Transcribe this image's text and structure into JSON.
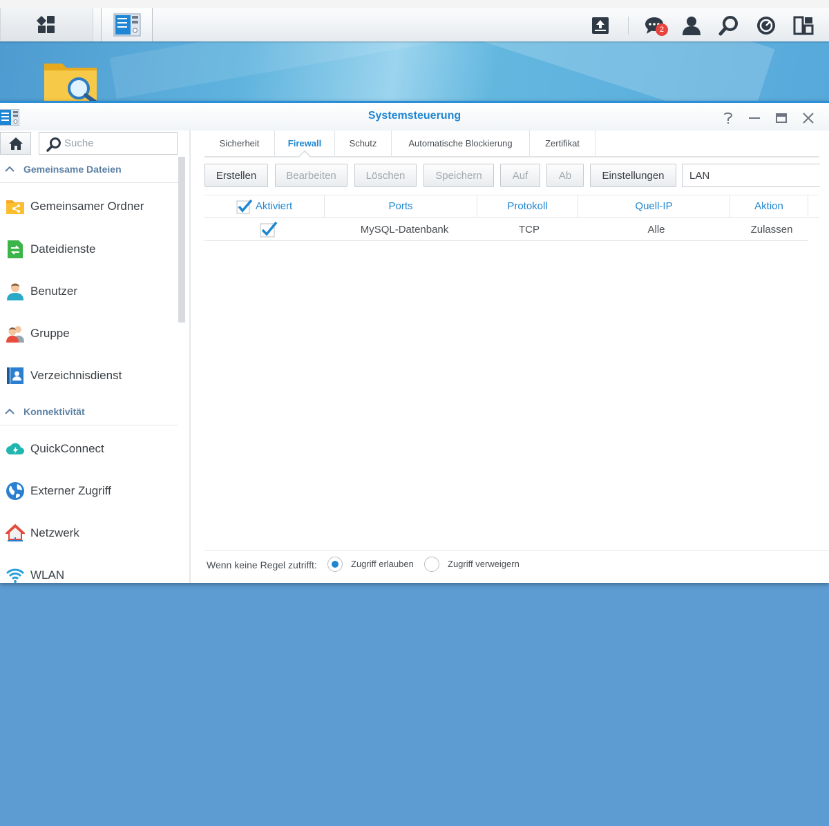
{
  "taskbar": {
    "main_menu_icon": "main-menu-icon",
    "control_panel_icon": "control-panel-icon",
    "right_icons": [
      "upload-icon",
      "notifications-icon",
      "user-icon",
      "search-icon",
      "resource-monitor-icon",
      "widgets-icon"
    ],
    "notification_count": "2"
  },
  "desktop": {
    "icon": "file-station-icon"
  },
  "window": {
    "title": "Systemsteuerung",
    "controls": [
      "help-icon",
      "minimize-icon",
      "maximize-icon",
      "close-icon"
    ]
  },
  "sidebar": {
    "search_placeholder": "Suche",
    "sections": [
      {
        "title": "Gemeinsame Dateien",
        "items": [
          {
            "label": "Gemeinsamer Ordner",
            "icon": "shared-folder-icon"
          },
          {
            "label": "Dateidienste",
            "icon": "file-services-icon"
          },
          {
            "label": "Benutzer",
            "icon": "user-icon"
          },
          {
            "label": "Gruppe",
            "icon": "group-icon"
          },
          {
            "label": "Verzeichnisdienst",
            "icon": "directory-service-icon"
          }
        ]
      },
      {
        "title": "Konnektivität",
        "items": [
          {
            "label": "QuickConnect",
            "icon": "quickconnect-icon"
          },
          {
            "label": "Externer Zugriff",
            "icon": "external-access-icon"
          },
          {
            "label": "Netzwerk",
            "icon": "network-icon"
          },
          {
            "label": "WLAN",
            "icon": "wlan-icon"
          }
        ]
      }
    ]
  },
  "tabs": [
    {
      "label": "Sicherheit",
      "active": false
    },
    {
      "label": "Firewall",
      "active": true
    },
    {
      "label": "Schutz",
      "active": false
    },
    {
      "label": "Automatische Blockierung",
      "active": false
    },
    {
      "label": "Zertifikat",
      "active": false
    }
  ],
  "toolbar": {
    "buttons": [
      {
        "label": "Erstellen",
        "enabled": true
      },
      {
        "label": "Bearbeiten",
        "enabled": false
      },
      {
        "label": "Löschen",
        "enabled": false
      },
      {
        "label": "Speichern",
        "enabled": false
      },
      {
        "label": "Auf",
        "enabled": false
      },
      {
        "label": "Ab",
        "enabled": false
      },
      {
        "label": "Einstellungen",
        "enabled": true
      }
    ],
    "interface": "LAN"
  },
  "table": {
    "columns": [
      "Aktiviert",
      "Ports",
      "Protokoll",
      "Quell-IP",
      "Aktion"
    ],
    "header_checked": true,
    "rows": [
      {
        "enabled": true,
        "ports": "MySQL-Datenbank",
        "protocol": "TCP",
        "source_ip": "Alle",
        "action": "Zulassen"
      }
    ]
  },
  "footer": {
    "label": "Wenn keine Regel zutrifft:",
    "options": [
      {
        "label": "Zugriff erlauben",
        "selected": true
      },
      {
        "label": "Zugriff verweigern",
        "selected": false
      }
    ]
  },
  "colors": {
    "accent": "#1e86d2",
    "desktop": "#5c9cd2",
    "section_header": "#5b7fa3"
  }
}
